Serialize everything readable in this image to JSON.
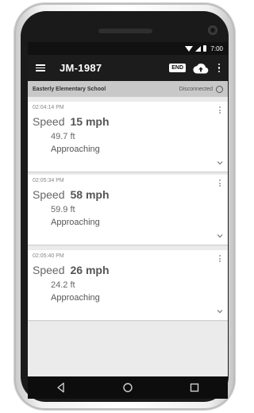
{
  "status_bar": {
    "time": "7:00"
  },
  "app_bar": {
    "title": "JM-1987",
    "end_label": "END"
  },
  "sub_bar": {
    "school": "Easterly Elementary School",
    "connection": "Disconnected"
  },
  "readings": [
    {
      "time": "02:04:14 PM",
      "speed_label": "Speed",
      "speed": "15 mph",
      "distance": "49.7 ft",
      "status": "Approaching"
    },
    {
      "time": "02:05:34 PM",
      "speed_label": "Speed",
      "speed": "58 mph",
      "distance": "59.9 ft",
      "status": "Approaching"
    },
    {
      "time": "02:05:40 PM",
      "speed_label": "Speed",
      "speed": "26 mph",
      "distance": "24.2 ft",
      "status": "Approaching"
    }
  ],
  "icons": {
    "menu": "hamburger-menu-icon",
    "upload": "cloud-upload-icon",
    "more": "more-vert-icon",
    "expand": "chevron-down-icon",
    "back": "nav-back-icon",
    "home": "nav-home-icon",
    "recents": "nav-recents-icon"
  },
  "colors": {
    "app_bar": "#1c1c1c",
    "sub_bar": "#c8c8c8",
    "background": "#ebebeb"
  }
}
